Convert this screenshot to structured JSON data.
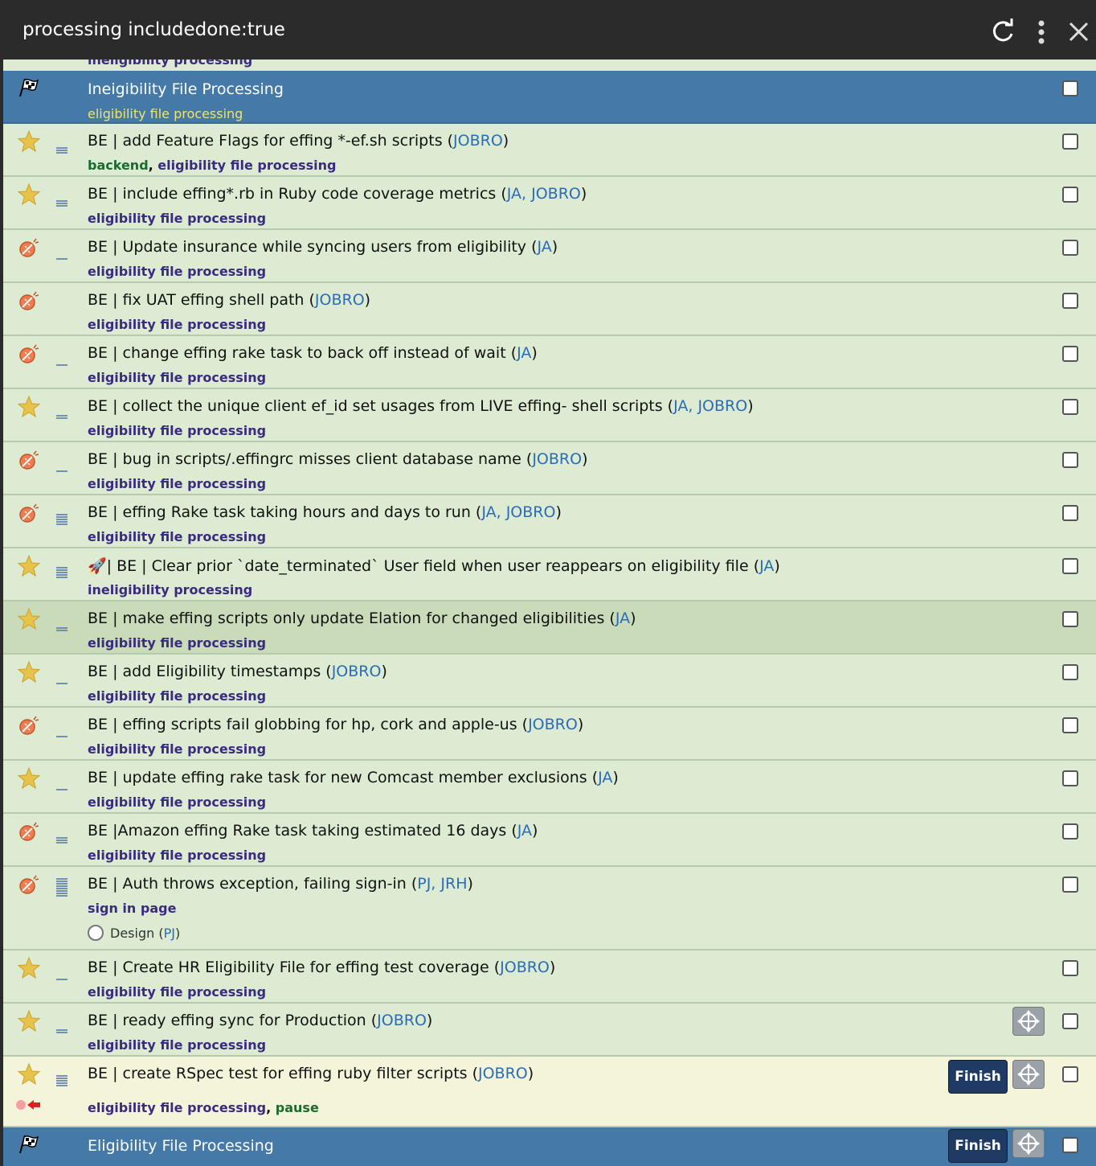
{
  "window": {
    "title": "processing includedone:true",
    "icons": {
      "refresh": "refresh-icon",
      "more": "more-vertical-icon",
      "close": "close-icon"
    }
  },
  "colors": {
    "row_bg": "#dcebd1",
    "header_bg": "#4479a8",
    "highlight_bg": "#c9dbb8",
    "active_bg": "#f4f4da",
    "tag_color": "#3b2a82",
    "assignee_color": "#2b6cb8",
    "finish_button": "#1f3a63"
  },
  "top_peek_tag": "ineligibility processing",
  "header1": {
    "title": "Ineigibility File Processing",
    "tag": "eligibility file processing"
  },
  "tasks": [
    {
      "icon": "star",
      "priority": "medium",
      "title": "BE | add Feature Flags for effing *-ef.sh scripts (",
      "assignees": "JOBRO",
      "close": ")",
      "tags": [
        {
          "text": "backend",
          "color": "green"
        },
        {
          "text": "eligibility file processing",
          "color": "purple"
        }
      ]
    },
    {
      "icon": "star",
      "priority": "medium",
      "title": "BE | include effing*.rb in Ruby code coverage metrics (",
      "assignees": "JA, JOBRO",
      "close": ")",
      "tags": [
        {
          "text": "eligibility file processing",
          "color": "purple"
        }
      ]
    },
    {
      "icon": "bug",
      "priority": "low",
      "title": "BE | Update insurance while syncing users from eligibility (",
      "assignees": "JA",
      "close": ")",
      "tags": [
        {
          "text": "eligibility file processing",
          "color": "purple"
        }
      ]
    },
    {
      "icon": "bug",
      "priority": "none",
      "title": "BE | fix UAT effing shell path (",
      "assignees": "JOBRO",
      "close": ")",
      "tags": [
        {
          "text": "eligibility file processing",
          "color": "purple"
        }
      ]
    },
    {
      "icon": "bug",
      "priority": "low",
      "title": "BE | change effing rake task to back off instead of wait (",
      "assignees": "JA",
      "close": ")",
      "tags": [
        {
          "text": "eligibility file processing",
          "color": "purple"
        }
      ]
    },
    {
      "icon": "star",
      "priority": "medium-low",
      "title": "BE | collect the unique client ef_id set usages from LIVE effing- shell scripts (",
      "assignees": "JA, JOBRO",
      "close": ")",
      "tags": [
        {
          "text": "eligibility file processing",
          "color": "purple"
        }
      ]
    },
    {
      "icon": "bug",
      "priority": "low",
      "title": "BE | bug in scripts/.effingrc misses client database name (",
      "assignees": "JOBRO",
      "close": ")",
      "tags": [
        {
          "text": "eligibility file processing",
          "color": "purple"
        }
      ]
    },
    {
      "icon": "bug",
      "priority": "high",
      "title": "BE | effing Rake task taking hours and days to run (",
      "assignees": "JA, JOBRO",
      "close": ")",
      "tags": [
        {
          "text": "eligibility file processing",
          "color": "purple"
        }
      ]
    },
    {
      "icon": "star",
      "priority": "high",
      "title": "🚀| BE | Clear prior `date_terminated` User field when user reappears on eligibility file (",
      "assignees": "JA",
      "close": ")",
      "tags": [
        {
          "text": "ineligibility processing",
          "color": "purple"
        }
      ]
    },
    {
      "icon": "star",
      "priority": "medium-low",
      "title": "BE | make effing scripts only update Elation for changed eligibilities (",
      "assignees": "JA",
      "close": ")",
      "tags": [
        {
          "text": "eligibility file processing",
          "color": "purple"
        }
      ],
      "highlight": true
    },
    {
      "icon": "star",
      "priority": "low",
      "title": "BE | add Eligibility timestamps (",
      "assignees": "JOBRO",
      "close": ")",
      "tags": [
        {
          "text": "eligibility file processing",
          "color": "purple"
        }
      ]
    },
    {
      "icon": "bug",
      "priority": "low",
      "title": "BE | effing scripts fail globbing for hp, cork and apple-us (",
      "assignees": "JOBRO",
      "close": ")",
      "tags": [
        {
          "text": "eligibility file processing",
          "color": "purple"
        }
      ]
    },
    {
      "icon": "star",
      "priority": "low",
      "title": "BE | update effing rake task for new Comcast member exclusions (",
      "assignees": "JA",
      "close": ")",
      "tags": [
        {
          "text": "eligibility file processing",
          "color": "purple"
        }
      ]
    },
    {
      "icon": "bug",
      "priority": "medium",
      "title": "BE |Amazon effing Rake task taking estimated 16 days (",
      "assignees": "JA",
      "close": ")",
      "tags": [
        {
          "text": "eligibility file processing",
          "color": "purple"
        }
      ]
    },
    {
      "icon": "bug",
      "priority": "urgent",
      "title": "BE | Auth throws exception, failing sign-in (",
      "assignees": "PJ, JRH",
      "close": ")",
      "tags": [
        {
          "text": "sign in page",
          "color": "purple"
        }
      ],
      "subtask": {
        "label": "Design (",
        "assignee": "PJ",
        "close": ")"
      }
    },
    {
      "icon": "star",
      "priority": "low",
      "title": "BE | Create HR Eligibility File for effing test coverage (",
      "assignees": "JOBRO",
      "close": ")",
      "tags": [
        {
          "text": "eligibility file processing",
          "color": "purple"
        }
      ]
    },
    {
      "icon": "star",
      "priority": "medium-low",
      "title": "BE | ready effing sync for Production (",
      "assignees": "JOBRO",
      "close": ")",
      "tags": [
        {
          "text": "eligibility file processing",
          "color": "purple"
        }
      ],
      "move": true
    },
    {
      "icon": "star",
      "priority": "high",
      "title": "BE | create RSpec test for effing ruby filter scripts (",
      "assignees": "JOBRO",
      "close": ")",
      "tags": [
        {
          "text": "eligibility file processing",
          "color": "purple"
        },
        {
          "text": "pause",
          "color": "green"
        }
      ],
      "active": true,
      "finish_label": "Finish",
      "move": true
    }
  ],
  "header2": {
    "title": "Eligibility File Processing",
    "finish_label": "Finish"
  }
}
